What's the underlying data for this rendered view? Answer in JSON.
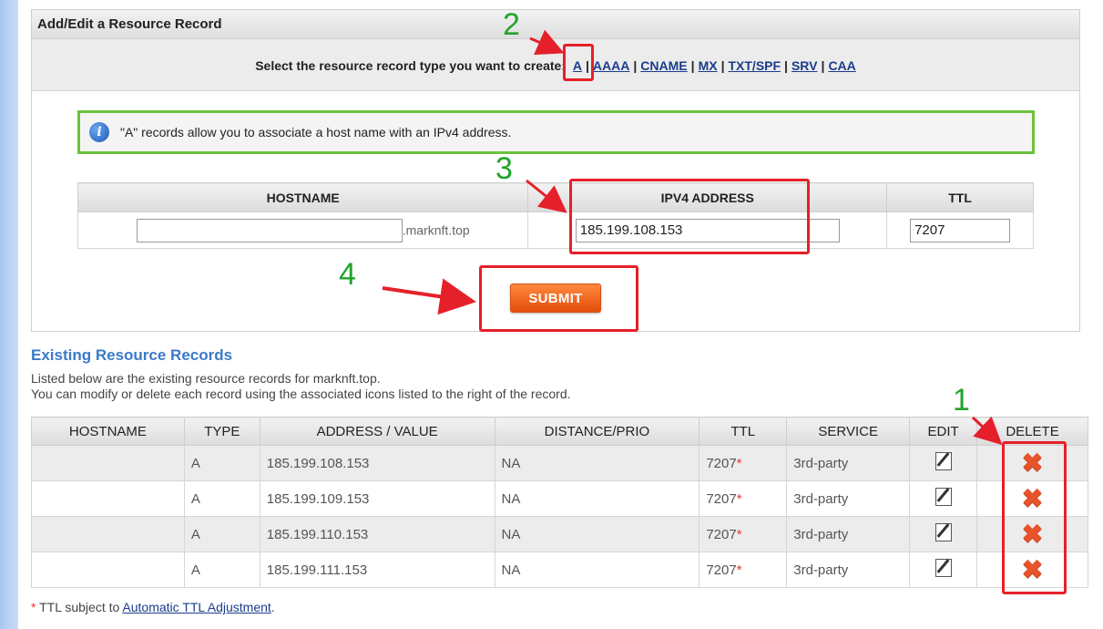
{
  "panel": {
    "title": "Add/Edit a Resource Record",
    "type_prompt": "Select the resource record type you want to create:",
    "types": [
      "A",
      "AAAA",
      "CNAME",
      "MX",
      "TXT/SPF",
      "SRV",
      "CAA"
    ],
    "info_text": "\"A\" records allow you to associate a host name with an IPv4 address.",
    "form": {
      "col_hostname": "HOSTNAME",
      "col_ipv4": "IPV4 ADDRESS",
      "col_ttl": "TTL",
      "hostname_value": "",
      "domain_suffix": ".marknft.top",
      "ipv4_value": "185.199.108.153",
      "ttl_value": "7207"
    },
    "submit_label": "SUBMIT"
  },
  "existing": {
    "title": "Existing Resource Records",
    "desc_line1": "Listed below are the existing resource records for marknft.top.",
    "desc_line2": "You can modify or delete each record using the associated icons listed to the right of the record.",
    "columns": [
      "HOSTNAME",
      "TYPE",
      "ADDRESS / VALUE",
      "DISTANCE/PRIO",
      "TTL",
      "SERVICE",
      "EDIT",
      "DELETE"
    ],
    "rows": [
      {
        "hostname": "",
        "type": "A",
        "address": "185.199.108.153",
        "prio": "NA",
        "ttl": "7207",
        "service": "3rd-party"
      },
      {
        "hostname": "",
        "type": "A",
        "address": "185.199.109.153",
        "prio": "NA",
        "ttl": "7207",
        "service": "3rd-party"
      },
      {
        "hostname": "",
        "type": "A",
        "address": "185.199.110.153",
        "prio": "NA",
        "ttl": "7207",
        "service": "3rd-party"
      },
      {
        "hostname": "",
        "type": "A",
        "address": "185.199.111.153",
        "prio": "NA",
        "ttl": "7207",
        "service": "3rd-party"
      }
    ],
    "star": "*"
  },
  "footnote": {
    "star": "*",
    "text": " TTL subject to ",
    "link": "Automatic TTL Adjustment",
    "end": "."
  },
  "annotations": {
    "n1": "1",
    "n2": "2",
    "n3": "3",
    "n4": "4"
  },
  "colors": {
    "highlight_box": "#e5202a",
    "step_number": "#22a32a",
    "info_border": "#6cc23a",
    "submit": "#f06a21",
    "link": "#1a3c8c"
  }
}
